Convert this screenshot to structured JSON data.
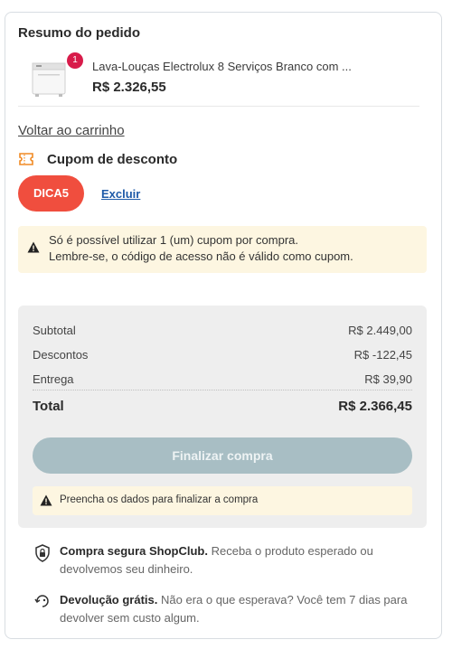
{
  "order_summary": {
    "title": "Resumo do pedido",
    "item": {
      "quantity": "1",
      "name": "Lava-Louças Electrolux 8 Serviços Branco com ...",
      "price": "R$ 2.326,55"
    }
  },
  "back_to_cart": "Voltar ao carrinho",
  "coupon": {
    "title": "Cupom de desconto",
    "code": "DICA5",
    "remove_label": "Excluir",
    "warning_line1": "Só é possível utilizar 1 (um) cupom por compra.",
    "warning_line2": "Lembre-se, o código de acesso não é válido como cupom."
  },
  "totals": {
    "subtotal_label": "Subtotal",
    "subtotal_value": "R$ 2.449,00",
    "discount_label": "Descontos",
    "discount_value": "R$ -122,45",
    "shipping_label": "Entrega",
    "shipping_value": "R$ 39,90",
    "total_label": "Total",
    "total_value": "R$ 2.366,45"
  },
  "checkout": {
    "button_label": "Finalizar compra",
    "notice": "Preencha os dados para finalizar a compra"
  },
  "assurances": {
    "secure_title": "Compra segura ShopClub.",
    "secure_text": "Receba o produto esperado ou devolvemos seu dinheiro.",
    "return_title": "Devolução grátis.",
    "return_text": "Não era o que esperava? Você tem 7 dias para devolver sem custo algum."
  },
  "colors": {
    "coupon_chip": "#f04e3e",
    "qty_badge": "#d81b4a",
    "link_blue": "#1e5aa8",
    "warning_bg": "#fdf6e1",
    "disabled_button": "#a8bec4"
  },
  "icons": [
    "dishwasher-product-image",
    "ticket-icon",
    "warning-icon",
    "shield-lock-icon",
    "return-tag-icon"
  ]
}
